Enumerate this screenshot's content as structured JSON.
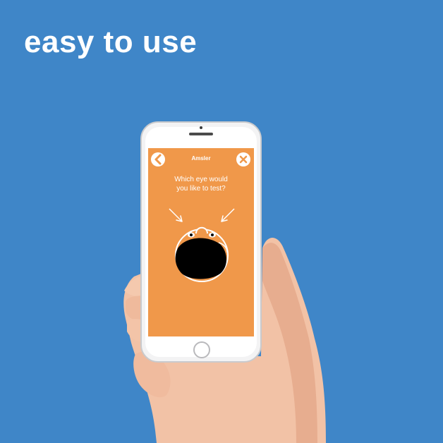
{
  "headline": "easy to use",
  "app": {
    "title": "Amsler",
    "question": "Which eye would\nyou like to test?",
    "accent_color": "#f0984a",
    "background_color": "#3f86c8"
  },
  "icons": {
    "back": "chevron-left-icon",
    "close": "close-icon",
    "left_arrow": "arrow-down-right-icon",
    "right_arrow": "arrow-down-left-icon",
    "face": "face-illustration"
  }
}
